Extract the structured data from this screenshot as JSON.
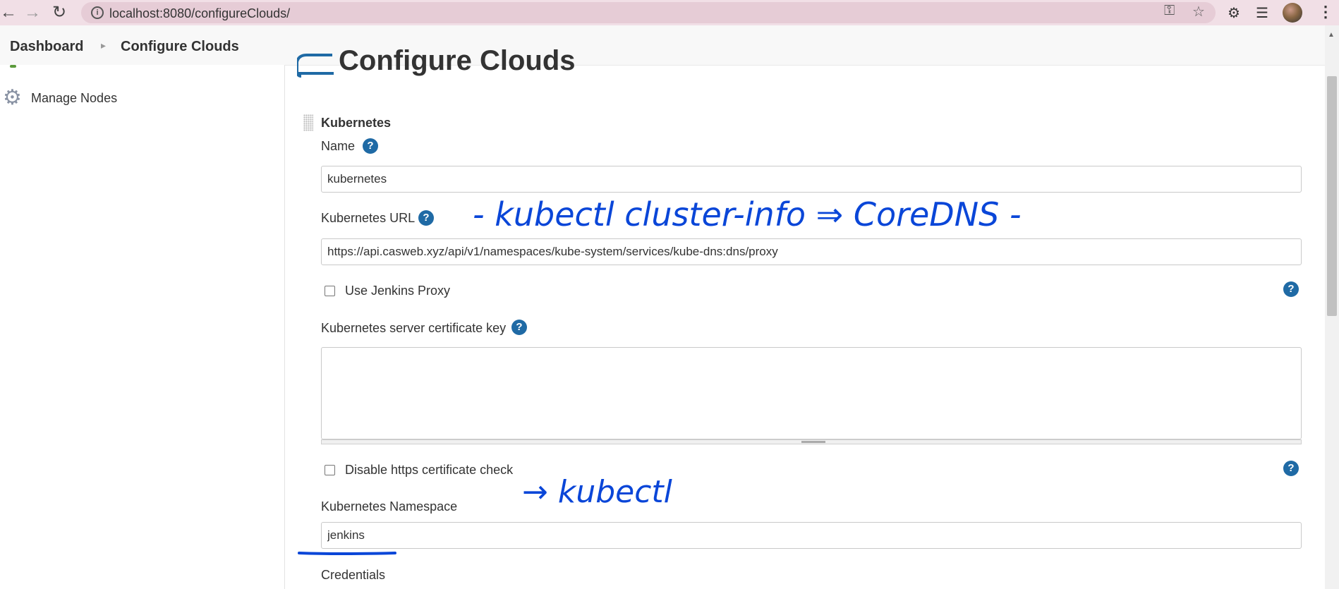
{
  "browser": {
    "url": "localhost:8080/configureClouds/",
    "icons": [
      "back-arrow-icon",
      "forward-arrow-icon",
      "reload-icon",
      "site-info-icon",
      "key-icon",
      "star-icon",
      "puzzle-icon",
      "media-playlist-icon",
      "profile-avatar",
      "menu-dots-icon"
    ]
  },
  "breadcrumb": {
    "home": "Dashboard",
    "current": "Configure Clouds"
  },
  "sidebar": {
    "items": [
      {
        "label": "Manage Nodes",
        "icon": "gear-icon"
      }
    ]
  },
  "main": {
    "title": "Configure Clouds",
    "section": "Kubernetes",
    "fields": {
      "name": {
        "label": "Name",
        "value": "kubernetes"
      },
      "url": {
        "label": "Kubernetes URL",
        "value": "https://api.casweb.xyz/api/v1/namespaces/kube-system/services/kube-dns:dns/proxy"
      },
      "use_proxy": {
        "label": "Use Jenkins Proxy",
        "checked": false
      },
      "cert_key": {
        "label": "Kubernetes server certificate key",
        "value": ""
      },
      "disable_https": {
        "label": "Disable https certificate check",
        "checked": false
      },
      "namespace": {
        "label": "Kubernetes Namespace",
        "value": "jenkins"
      },
      "credentials": {
        "label": "Credentials"
      }
    },
    "help_symbol": "?"
  },
  "annotations": {
    "line1": "- kubectl cluster-info ⇒ CoreDNS -",
    "line2": "→ kubectl"
  },
  "colors": {
    "accent": "#1f6aa5",
    "ink": "#0a46d8",
    "browser_bar": "#f1dfe6"
  }
}
